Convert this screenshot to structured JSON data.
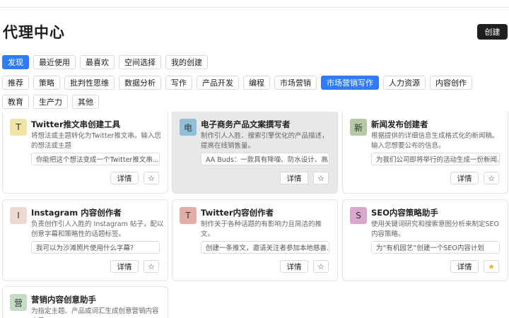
{
  "header": {
    "title": "代理中心",
    "create_label": "创建"
  },
  "tabs": [
    "发现",
    "最近使用",
    "最喜欢",
    "空间选择",
    "我的创建"
  ],
  "categories": [
    "推荐",
    "策略",
    "批判性思维",
    "数据分析",
    "写作",
    "产品开发",
    "编程",
    "市场营销",
    "市场营销写作",
    "人力资源",
    "内容创作",
    "教育",
    "生产力",
    "其他"
  ],
  "active_tab": "发现",
  "active_category": "市场营销写作",
  "colors": {
    "accent": "#2f7cf6",
    "star_active": "#e8b23a"
  },
  "card_common": {
    "detail_label": "详情",
    "star_icon": "star-icon"
  },
  "cards": [
    {
      "avatar": "T",
      "avatar_color": "#efe3a6",
      "title": "Twitter推文串创建工具",
      "desc": "将想法或主题转化为Twitter推文串。输入您的想法或主题",
      "example": "你能把这个想法变成一个Twitter推文串...",
      "starred": false
    },
    {
      "avatar": "电",
      "avatar_color": "#8fbfd9",
      "title": "电子商务产品文案撰写者",
      "desc": "制作引人入胜、搜索引擎优化的产品描述，提高在线销售量。",
      "example": "AA Buds：一款具有降噪、防水设计、高...",
      "starred": false
    },
    {
      "avatar": "新",
      "avatar_color": "#b5c9a4",
      "title": "新闻发布创建者",
      "desc": "根据提供的详细信息生成格式化的新闻稿。输入您想要公布的信息。",
      "example": "为我们公司即将举行的活动生成一份新闻...",
      "starred": false
    },
    {
      "avatar": "I",
      "avatar_color": "#ecd9cf",
      "title": "Instagram 内容创作者",
      "desc": "负责创作引人入胜的 Instagram 帖子，配以创意字幕和策略性的话题标签。",
      "example": "我可以为沙滩照片使用什么字幕?",
      "starred": false
    },
    {
      "avatar": "T",
      "avatar_color": "#e2aca7",
      "title": "Twitter内容创作者",
      "desc": "制作关于各种话题的有影响力且简洁的推文。",
      "example": "创建一条推文，邀请关注者参加本地慈善...",
      "starred": false
    },
    {
      "avatar": "S",
      "avatar_color": "#d9a6cc",
      "title": "SEO内容策略助手",
      "desc": "使用关键词研究和搜索意图分析来制定SEO内容策略。",
      "example": "为“有机园艺”创建一个SEO内容计划",
      "starred": true
    },
    {
      "avatar": "营",
      "avatar_color": "#c4dcc4",
      "title": "营销内容创意助手",
      "desc": "为指定主题、产品或词汇生成创意营销内容点子。",
      "example": "",
      "starred": false
    }
  ]
}
